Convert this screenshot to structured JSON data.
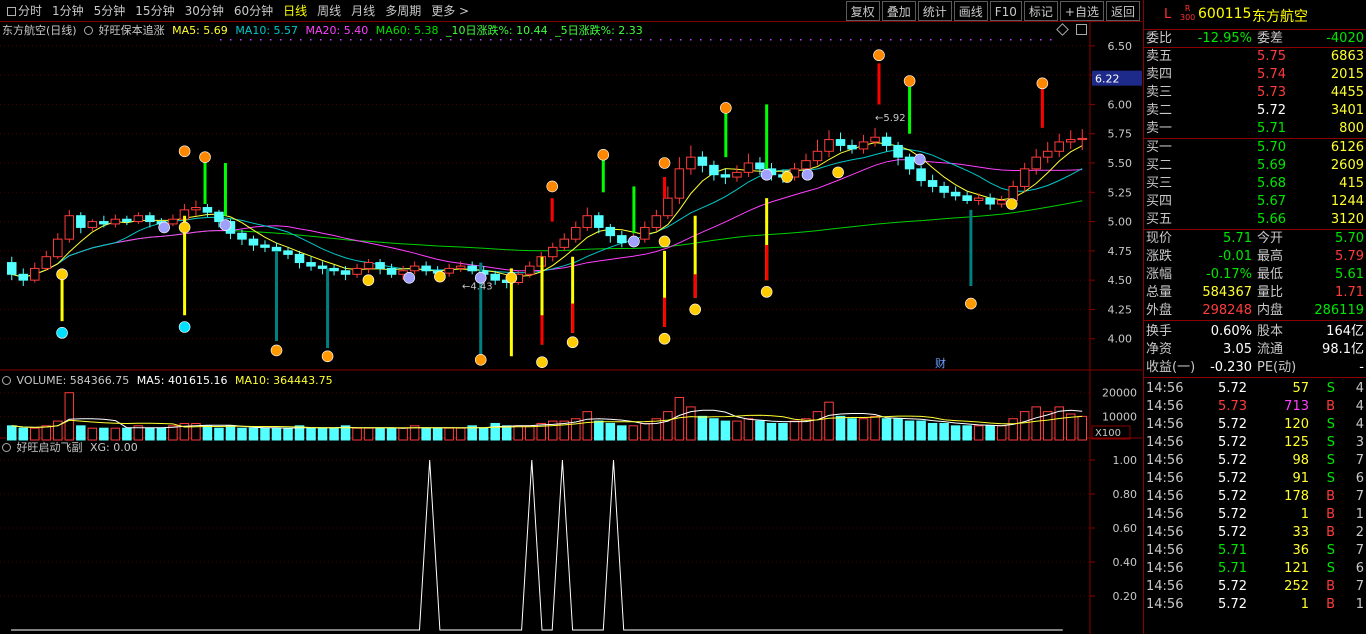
{
  "toolbar": {
    "periods": [
      "分时",
      "1分钟",
      "5分钟",
      "15分钟",
      "30分钟",
      "60分钟",
      "日线",
      "周线",
      "月线",
      "多周期",
      "更多 >"
    ],
    "active_period": "日线",
    "actions": [
      "复权",
      "叠加",
      "统计",
      "画线",
      "F10",
      "标记",
      "+自选",
      "返回"
    ]
  },
  "main_header": {
    "stock_label": "东方航空(日线)",
    "indicator_name": "好旺保本追涨",
    "ma5": "MA5: 5.69",
    "ma10": "MA10: 5.57",
    "ma20": "MA20: 5.40",
    "ma60": "MA60: 5.38",
    "chg10": "_10日涨跌%: 10.44",
    "chg5": "_5日涨跌%: 2.33"
  },
  "price_axis": [
    "6.50",
    "6.25",
    "6.00",
    "5.75",
    "5.50",
    "5.25",
    "5.00",
    "4.75",
    "4.50",
    "4.25",
    "4.00"
  ],
  "current_price_tag": "6.22",
  "annotations": {
    "high_label": "5.92",
    "low_label": "4.43",
    "finance_marker": "财"
  },
  "volume_header": {
    "label": "VOLUME: 584366.75",
    "ma5": "MA5: 401615.16",
    "ma10": "MA10: 364443.75"
  },
  "volume_axis": [
    "20000",
    "10000"
  ],
  "volume_unit": "X100",
  "sub_header": {
    "label": "好旺启动飞副",
    "xg": "XG: 0.00"
  },
  "sub_axis": [
    "1.00",
    "0.80",
    "0.60",
    "0.40",
    "0.20"
  ],
  "stock": {
    "code": "600115",
    "name": "东方航空",
    "market_tag": "L",
    "index_tag": "R\n300"
  },
  "order_book": {
    "ratio_label": "委比",
    "ratio_value": "-12.95%",
    "diff_label": "委差",
    "diff_value": "-4020",
    "asks": [
      {
        "label": "卖五",
        "price": "5.75",
        "vol": "6863"
      },
      {
        "label": "卖四",
        "price": "5.74",
        "vol": "2015"
      },
      {
        "label": "卖三",
        "price": "5.73",
        "vol": "4455"
      },
      {
        "label": "卖二",
        "price": "5.72",
        "vol": "3401"
      },
      {
        "label": "卖一",
        "price": "5.71",
        "vol": "800"
      }
    ],
    "bids": [
      {
        "label": "买一",
        "price": "5.70",
        "vol": "6126"
      },
      {
        "label": "买二",
        "price": "5.69",
        "vol": "2609"
      },
      {
        "label": "买三",
        "price": "5.68",
        "vol": "415"
      },
      {
        "label": "买四",
        "price": "5.67",
        "vol": "1244"
      },
      {
        "label": "买五",
        "price": "5.66",
        "vol": "3120"
      }
    ]
  },
  "quote": {
    "price_label": "现价",
    "price": "5.71",
    "open_label": "今开",
    "open": "5.70",
    "change_label": "涨跌",
    "change": "-0.01",
    "high_label": "最高",
    "high": "5.79",
    "pct_label": "涨幅",
    "pct": "-0.17%",
    "low_label": "最低",
    "low": "5.61",
    "total_label": "总量",
    "total": "584367",
    "vr_label": "量比",
    "vr": "1.71",
    "outer_label": "外盘",
    "outer": "298248",
    "inner_label": "内盘",
    "inner": "286119"
  },
  "fundamentals": {
    "turnover_label": "换手",
    "turnover": "0.60%",
    "equity_label": "股本",
    "equity": "164亿",
    "nav_label": "净资",
    "nav": "3.05",
    "float_label": "流通",
    "float": "98.1亿",
    "eps_label": "收益(一)",
    "eps": "-0.230",
    "pe_label": "PE(动)",
    "pe": "-"
  },
  "ticks": [
    {
      "time": "14:56",
      "price": "5.72",
      "vol": "57",
      "bs": "S",
      "n": "4"
    },
    {
      "time": "14:56",
      "price": "5.73",
      "vol": "713",
      "bs": "B",
      "n": "4"
    },
    {
      "time": "14:56",
      "price": "5.72",
      "vol": "120",
      "bs": "S",
      "n": "4"
    },
    {
      "time": "14:56",
      "price": "5.72",
      "vol": "125",
      "bs": "S",
      "n": "3"
    },
    {
      "time": "14:56",
      "price": "5.72",
      "vol": "98",
      "bs": "S",
      "n": "7"
    },
    {
      "time": "14:56",
      "price": "5.72",
      "vol": "91",
      "bs": "S",
      "n": "6"
    },
    {
      "time": "14:56",
      "price": "5.72",
      "vol": "178",
      "bs": "B",
      "n": "7"
    },
    {
      "time": "14:56",
      "price": "5.72",
      "vol": "1",
      "bs": "B",
      "n": "1"
    },
    {
      "time": "14:56",
      "price": "5.72",
      "vol": "33",
      "bs": "B",
      "n": "2"
    },
    {
      "time": "14:56",
      "price": "5.71",
      "vol": "36",
      "bs": "S",
      "n": "7"
    },
    {
      "time": "14:56",
      "price": "5.71",
      "vol": "121",
      "bs": "S",
      "n": "6"
    },
    {
      "time": "14:56",
      "price": "5.72",
      "vol": "252",
      "bs": "B",
      "n": "7"
    },
    {
      "time": "14:56",
      "price": "5.72",
      "vol": "1",
      "bs": "B",
      "n": "1"
    }
  ],
  "chart_data": {
    "type": "candlestick",
    "price_range": [
      3.75,
      6.55
    ],
    "candles": [
      [
        4.65,
        4.55,
        4.7,
        4.5
      ],
      [
        4.55,
        4.5,
        4.6,
        4.45
      ],
      [
        4.5,
        4.6,
        4.65,
        4.48
      ],
      [
        4.6,
        4.7,
        4.75,
        4.58
      ],
      [
        4.7,
        4.85,
        4.9,
        4.68
      ],
      [
        4.85,
        5.05,
        5.1,
        4.82
      ],
      [
        5.05,
        4.95,
        5.08,
        4.9
      ],
      [
        4.95,
        5.0,
        5.02,
        4.92
      ],
      [
        5.0,
        4.98,
        5.05,
        4.95
      ],
      [
        4.98,
        5.02,
        5.06,
        4.95
      ],
      [
        5.02,
        5.0,
        5.05,
        4.97
      ],
      [
        5.0,
        5.05,
        5.08,
        4.98
      ],
      [
        5.05,
        5.0,
        5.08,
        4.95
      ],
      [
        5.0,
        4.98,
        5.03,
        4.94
      ],
      [
        4.98,
        5.02,
        5.06,
        4.96
      ],
      [
        5.02,
        5.1,
        5.15,
        5.0
      ],
      [
        5.1,
        5.12,
        5.18,
        5.05
      ],
      [
        5.12,
        5.08,
        5.15,
        5.04
      ],
      [
        5.08,
        5.0,
        5.1,
        4.95
      ],
      [
        5.0,
        4.9,
        5.02,
        4.85
      ],
      [
        4.9,
        4.85,
        4.93,
        4.8
      ],
      [
        4.85,
        4.8,
        4.88,
        4.75
      ],
      [
        4.8,
        4.78,
        4.84,
        4.74
      ],
      [
        4.78,
        4.75,
        4.82,
        4.7
      ],
      [
        4.75,
        4.72,
        4.78,
        4.68
      ],
      [
        4.72,
        4.65,
        4.75,
        4.6
      ],
      [
        4.65,
        4.62,
        4.7,
        4.58
      ],
      [
        4.62,
        4.6,
        4.66,
        4.55
      ],
      [
        4.6,
        4.58,
        4.63,
        4.54
      ],
      [
        4.58,
        4.55,
        4.62,
        4.5
      ],
      [
        4.55,
        4.6,
        4.64,
        4.52
      ],
      [
        4.6,
        4.65,
        4.68,
        4.56
      ],
      [
        4.65,
        4.6,
        4.68,
        4.55
      ],
      [
        4.6,
        4.55,
        4.64,
        4.52
      ],
      [
        4.55,
        4.58,
        4.62,
        4.5
      ],
      [
        4.58,
        4.62,
        4.66,
        4.55
      ],
      [
        4.62,
        4.58,
        4.66,
        4.54
      ],
      [
        4.58,
        4.56,
        4.62,
        4.52
      ],
      [
        4.56,
        4.6,
        4.64,
        4.53
      ],
      [
        4.6,
        4.62,
        4.66,
        4.57
      ],
      [
        4.62,
        4.58,
        4.66,
        4.55
      ],
      [
        4.58,
        4.55,
        4.62,
        4.5
      ],
      [
        4.55,
        4.5,
        4.58,
        4.46
      ],
      [
        4.5,
        4.48,
        4.54,
        4.43
      ],
      [
        4.48,
        4.55,
        4.58,
        4.46
      ],
      [
        4.55,
        4.62,
        4.66,
        4.52
      ],
      [
        4.62,
        4.7,
        4.74,
        4.6
      ],
      [
        4.7,
        4.78,
        4.82,
        4.66
      ],
      [
        4.78,
        4.85,
        4.9,
        4.75
      ],
      [
        4.85,
        4.95,
        5.0,
        4.82
      ],
      [
        4.95,
        5.05,
        5.12,
        4.92
      ],
      [
        5.05,
        4.95,
        5.08,
        4.9
      ],
      [
        4.95,
        4.88,
        4.98,
        4.82
      ],
      [
        4.88,
        4.82,
        4.92,
        4.78
      ],
      [
        4.82,
        4.85,
        4.9,
        4.78
      ],
      [
        4.85,
        4.95,
        5.0,
        4.82
      ],
      [
        4.95,
        5.05,
        5.1,
        4.92
      ],
      [
        5.05,
        5.2,
        5.3,
        5.02
      ],
      [
        5.2,
        5.45,
        5.55,
        5.15
      ],
      [
        5.45,
        5.55,
        5.65,
        5.4
      ],
      [
        5.55,
        5.48,
        5.6,
        5.42
      ],
      [
        5.48,
        5.4,
        5.52,
        5.35
      ],
      [
        5.4,
        5.38,
        5.45,
        5.32
      ],
      [
        5.38,
        5.42,
        5.48,
        5.34
      ],
      [
        5.42,
        5.5,
        5.58,
        5.38
      ],
      [
        5.5,
        5.45,
        5.55,
        5.4
      ],
      [
        5.45,
        5.4,
        5.5,
        5.35
      ],
      [
        5.4,
        5.38,
        5.44,
        5.33
      ],
      [
        5.38,
        5.45,
        5.5,
        5.35
      ],
      [
        5.45,
        5.52,
        5.58,
        5.42
      ],
      [
        5.52,
        5.6,
        5.7,
        5.48
      ],
      [
        5.6,
        5.7,
        5.78,
        5.55
      ],
      [
        5.7,
        5.65,
        5.76,
        5.6
      ],
      [
        5.65,
        5.62,
        5.7,
        5.58
      ],
      [
        5.62,
        5.68,
        5.74,
        5.58
      ],
      [
        5.68,
        5.72,
        5.8,
        5.64
      ],
      [
        5.72,
        5.65,
        5.76,
        5.6
      ],
      [
        5.65,
        5.55,
        5.68,
        5.48
      ],
      [
        5.55,
        5.45,
        5.58,
        5.4
      ],
      [
        5.45,
        5.35,
        5.48,
        5.3
      ],
      [
        5.35,
        5.3,
        5.4,
        5.25
      ],
      [
        5.3,
        5.25,
        5.34,
        5.2
      ],
      [
        5.25,
        5.22,
        5.3,
        5.18
      ],
      [
        5.22,
        5.18,
        5.26,
        5.15
      ],
      [
        5.18,
        5.2,
        5.24,
        5.14
      ],
      [
        5.2,
        5.15,
        5.24,
        5.1
      ],
      [
        5.15,
        5.18,
        5.22,
        5.12
      ],
      [
        5.18,
        5.3,
        5.35,
        5.15
      ],
      [
        5.3,
        5.45,
        5.5,
        5.25
      ],
      [
        5.45,
        5.55,
        5.62,
        5.4
      ],
      [
        5.55,
        5.6,
        5.68,
        5.5
      ],
      [
        5.6,
        5.68,
        5.75,
        5.55
      ],
      [
        5.68,
        5.7,
        5.78,
        5.62
      ],
      [
        5.7,
        5.71,
        5.79,
        5.61
      ]
    ],
    "volume": [
      6,
      5,
      5,
      6,
      8,
      20,
      6,
      5,
      5,
      5,
      5,
      6,
      5,
      5,
      6,
      7,
      7,
      6,
      5,
      6,
      5,
      5,
      5,
      5,
      5,
      6,
      5,
      5,
      5,
      6,
      5,
      5,
      5,
      5,
      5,
      6,
      5,
      5,
      5,
      5,
      6,
      5,
      7,
      6,
      6,
      6,
      7,
      8,
      8,
      9,
      12,
      8,
      7,
      6,
      6,
      7,
      9,
      12,
      18,
      14,
      10,
      9,
      8,
      8,
      9,
      8,
      7,
      7,
      8,
      9,
      12,
      16,
      10,
      9,
      9,
      10,
      9,
      9,
      8,
      8,
      7,
      7,
      6,
      6,
      6,
      6,
      6,
      9,
      12,
      14,
      12,
      14,
      11,
      10
    ],
    "sub_signals": [
      41,
      51,
      54,
      59
    ]
  }
}
